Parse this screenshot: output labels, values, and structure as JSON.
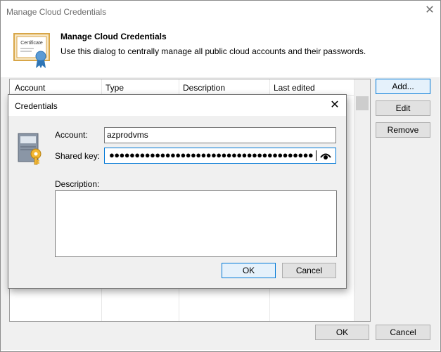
{
  "window": {
    "title": "Manage Cloud Credentials",
    "header_title": "Manage Cloud Credentials",
    "header_subtitle": "Use this dialog to centrally manage all public cloud accounts and their passwords.",
    "certificate_text": "Certificate"
  },
  "list": {
    "columns": [
      "Account",
      "Type",
      "Description",
      "Last edited"
    ]
  },
  "side_buttons": {
    "add": "Add...",
    "edit": "Edit",
    "remove": "Remove"
  },
  "footer": {
    "ok": "OK",
    "cancel": "Cancel"
  },
  "credentials_dialog": {
    "title": "Credentials",
    "account_label": "Account:",
    "account_value": "azprodvms",
    "shared_key_label": "Shared key:",
    "shared_key_mask": "●●●●●●●●●●●●●●●●●●●●●●●●●●●●●●●●●●●●●●●●●●",
    "description_label": "Description:",
    "description_value": "",
    "ok": "OK",
    "cancel": "Cancel"
  },
  "colors": {
    "focus_border": "#0078d7",
    "button_face": "#e1e1e1",
    "dialog_bg": "#f0f0f0"
  }
}
